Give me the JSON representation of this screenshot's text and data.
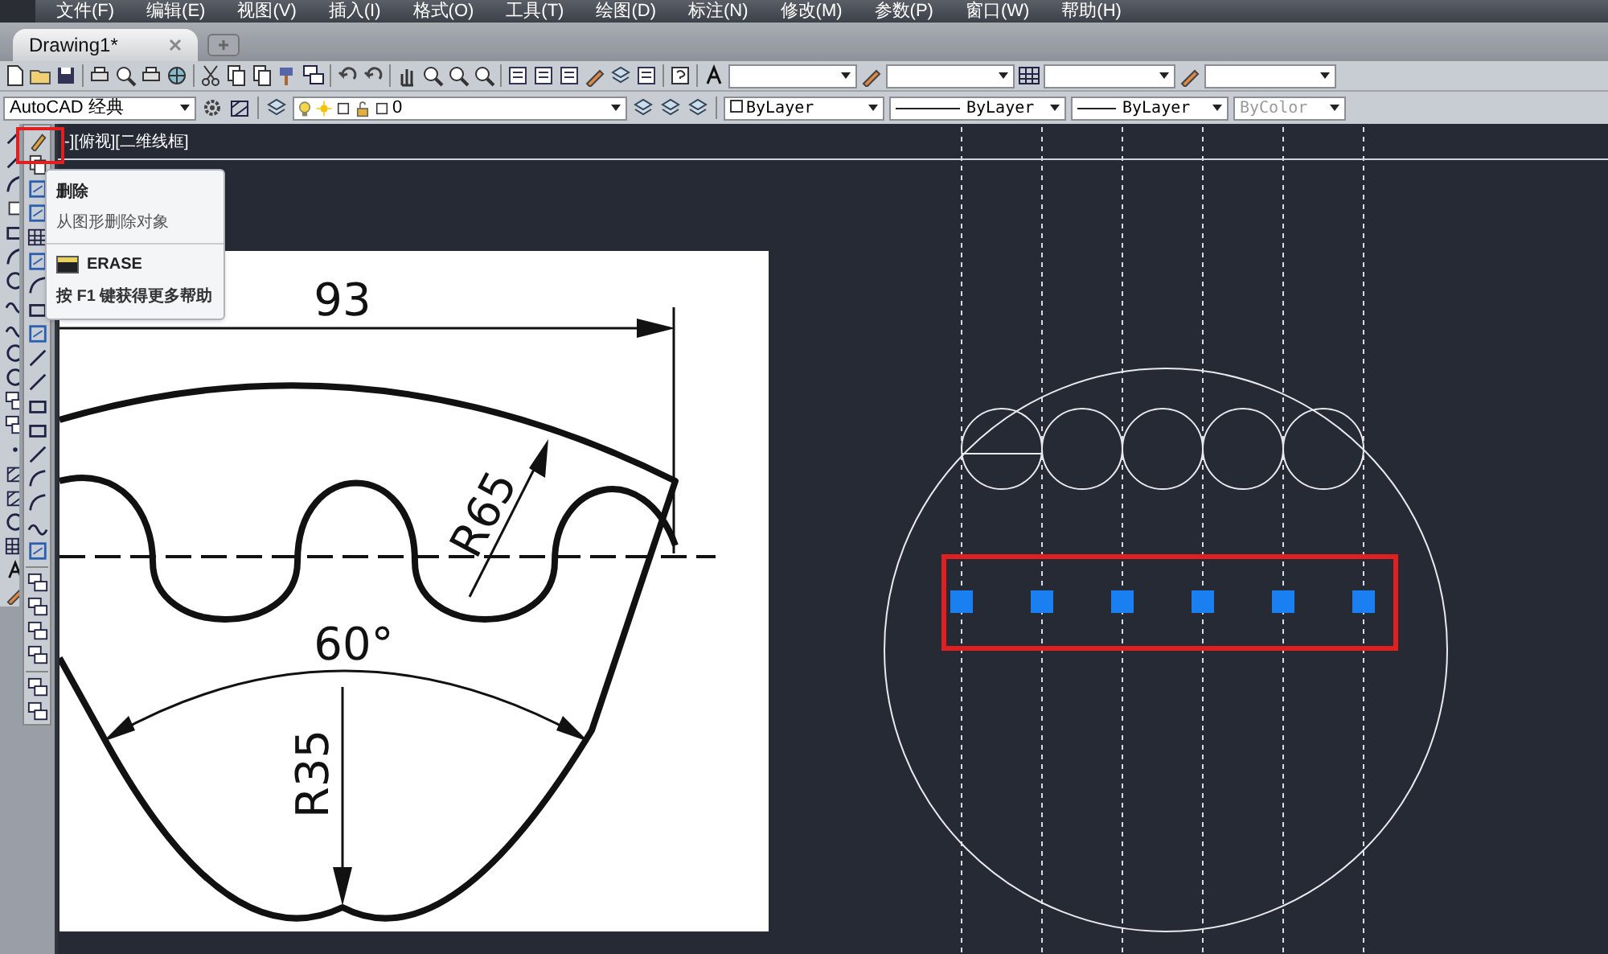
{
  "menu": [
    "文件(F)",
    "编辑(E)",
    "视图(V)",
    "插入(I)",
    "格式(O)",
    "工具(T)",
    "绘图(D)",
    "标注(N)",
    "修改(M)",
    "参数(P)",
    "窗口(W)",
    "帮助(H)"
  ],
  "tabs": [
    {
      "label": "Drawing1*",
      "selected": true
    }
  ],
  "toolbar": {
    "workspace": "AutoCAD 经典",
    "layer": "0",
    "color_setting": "ByLayer",
    "linetype": "ByLayer",
    "lineweight": "ByLayer",
    "plot_style": {
      "value": "ByColor",
      "disabled": true
    }
  },
  "viewport": {
    "label": "-][俯视][二维线框]"
  },
  "tooltip": {
    "title": "删除",
    "description": "从图形删除对象",
    "command": "ERASE",
    "help": "按 F1 键获得更多帮助"
  },
  "reference_drawing": {
    "width_dimension": "93",
    "outer_radius": "R65",
    "angle": "60°",
    "inner_radius": "R35"
  }
}
